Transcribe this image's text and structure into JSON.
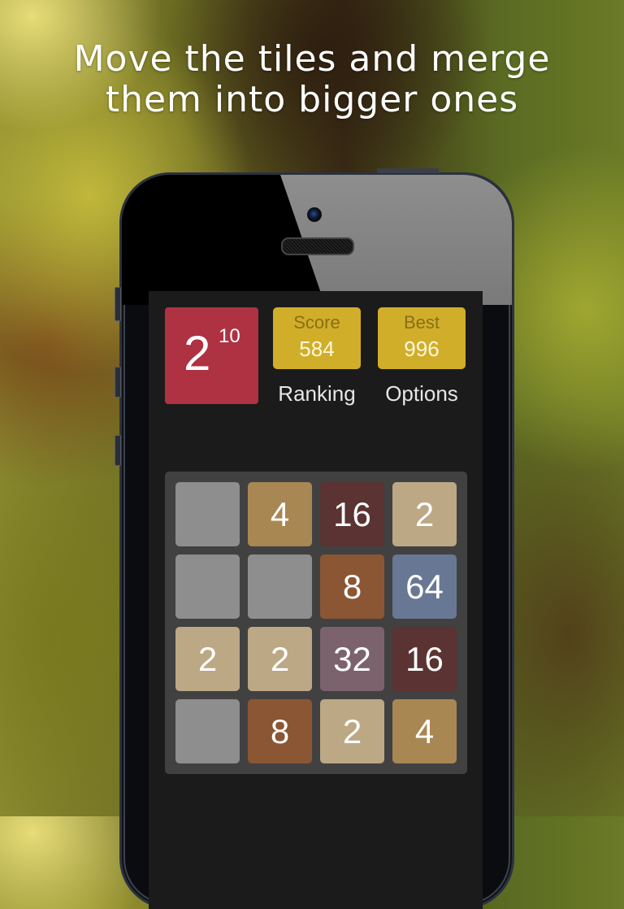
{
  "headline": {
    "line1": "Move the tiles and merge",
    "line2": "them into bigger ones"
  },
  "game": {
    "logo": {
      "base": "2",
      "exponent": "10",
      "color": "#ae3242"
    },
    "score": {
      "label": "Score",
      "value": "584"
    },
    "best": {
      "label": "Best",
      "value": "996"
    },
    "ranking_label": "Ranking",
    "options_label": "Options",
    "board": [
      [
        "",
        "4",
        "16",
        "2"
      ],
      [
        "",
        "",
        "8",
        "64"
      ],
      [
        "2",
        "2",
        "32",
        "16"
      ],
      [
        "",
        "8",
        "2",
        "4"
      ]
    ],
    "tile_colors": {
      "empty": "#8e8e8e",
      "2": "#bca885",
      "4": "#a98753",
      "8": "#8b5634",
      "16": "#5a3332",
      "32": "#7b626d",
      "64": "#687794"
    }
  }
}
